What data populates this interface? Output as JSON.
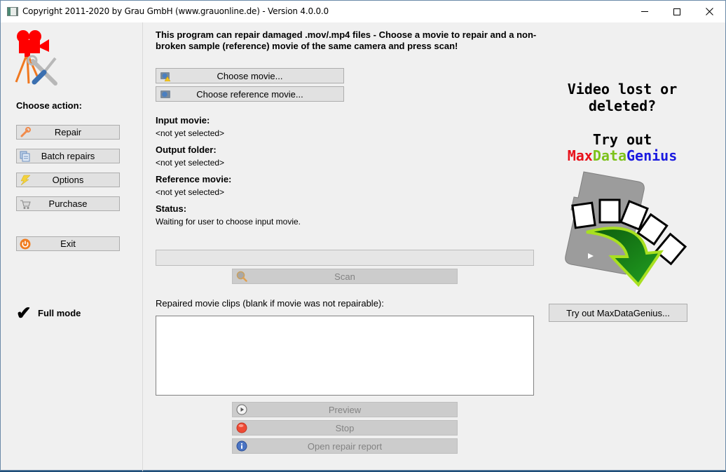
{
  "window": {
    "title": "Copyright 2011-2020 by Grau GmbH (www.grauonline.de) - Version 4.0.0.0",
    "controls": [
      "minimize",
      "maximize",
      "close"
    ]
  },
  "sidebar": {
    "heading": "Choose action:",
    "actions": [
      {
        "label": "Repair",
        "icon": "wrench-icon"
      },
      {
        "label": "Batch repairs",
        "icon": "documents-icon"
      },
      {
        "label": "Options",
        "icon": "lightning-icon"
      },
      {
        "label": "Purchase",
        "icon": "shopping-cart-icon"
      },
      {
        "label": "Exit",
        "icon": "power-icon"
      }
    ],
    "mode": {
      "check": "✔",
      "label": "Full mode"
    }
  },
  "main": {
    "intro": "This program can repair damaged .mov/.mp4 files - Choose a movie to repair and a non-broken sample (reference) movie of the same camera and press scan!",
    "choose_movie": "Choose movie...",
    "choose_reference": "Choose reference movie...",
    "fields": [
      {
        "label": "Input movie:",
        "value": "<not yet selected>"
      },
      {
        "label": "Output folder:",
        "value": "<not yet selected>"
      },
      {
        "label": "Reference movie:",
        "value": "<not yet selected>"
      },
      {
        "label": "Status:",
        "value": "Waiting for user to choose input movie."
      }
    ],
    "progress_percent": 0,
    "scan": "Scan",
    "clips_label": "Repaired movie clips (blank if movie was not repairable):",
    "clips": [],
    "preview": "Preview",
    "stop": "Stop",
    "open_report": "Open repair report"
  },
  "promo": {
    "headline_line1": "Video lost or",
    "headline_line2": "deleted?",
    "try_out": "Try out",
    "brand_parts": [
      {
        "text": "Max",
        "color": "#e8101a"
      },
      {
        "text": "Data",
        "color": "#7cc21a"
      },
      {
        "text": "Genius",
        "color": "#1a1ae0"
      }
    ],
    "button": "Try out MaxDataGenius..."
  }
}
